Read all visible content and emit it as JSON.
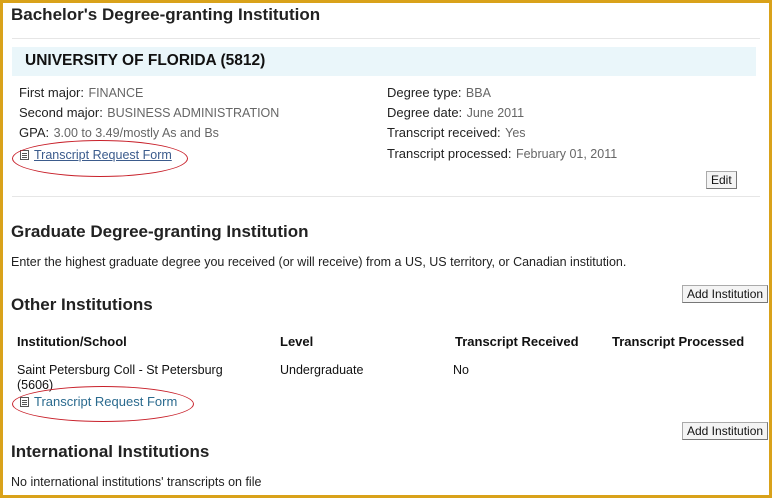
{
  "bachelor": {
    "heading": "Bachelor's Degree-granting Institution",
    "university": "UNIVERSITY OF FLORIDA (5812)",
    "first_major_label": "First major:",
    "first_major": "FINANCE",
    "second_major_label": "Second major:",
    "second_major": "BUSINESS ADMINISTRATION",
    "gpa_label": "GPA:",
    "gpa": "3.00 to 3.49/mostly As and Bs",
    "transcript_link": "Transcript Request Form",
    "degree_type_label": "Degree type:",
    "degree_type": "BBA",
    "degree_date_label": "Degree date:",
    "degree_date": "June 2011",
    "transcript_received_label": "Transcript received:",
    "transcript_received": "Yes",
    "transcript_processed_label": "Transcript processed:",
    "transcript_processed": "February 01, 2011",
    "edit_label": "Edit"
  },
  "graduate": {
    "heading": "Graduate Degree-granting Institution",
    "instructions": "Enter the highest graduate degree you received (or will receive) from a US, US territory, or Canadian institution."
  },
  "other": {
    "heading": "Other Institutions",
    "add_label": "Add Institution",
    "columns": [
      "Institution/School",
      "Level",
      "Transcript Received",
      "Transcript Processed"
    ],
    "row": {
      "institution": "Saint Petersburg Coll - St Petersburg",
      "code": "(5606)",
      "level": "Undergraduate",
      "received": "No",
      "processed": ""
    },
    "transcript_link": "Transcript Request Form"
  },
  "international": {
    "heading": "International Institutions",
    "add_label": "Add Institution",
    "empty_message": "No international institutions' transcripts on file"
  },
  "colors": {
    "frame": "#d9a21a",
    "highlight_oval": "#c8202a",
    "university_bar": "#eaf6fa"
  }
}
